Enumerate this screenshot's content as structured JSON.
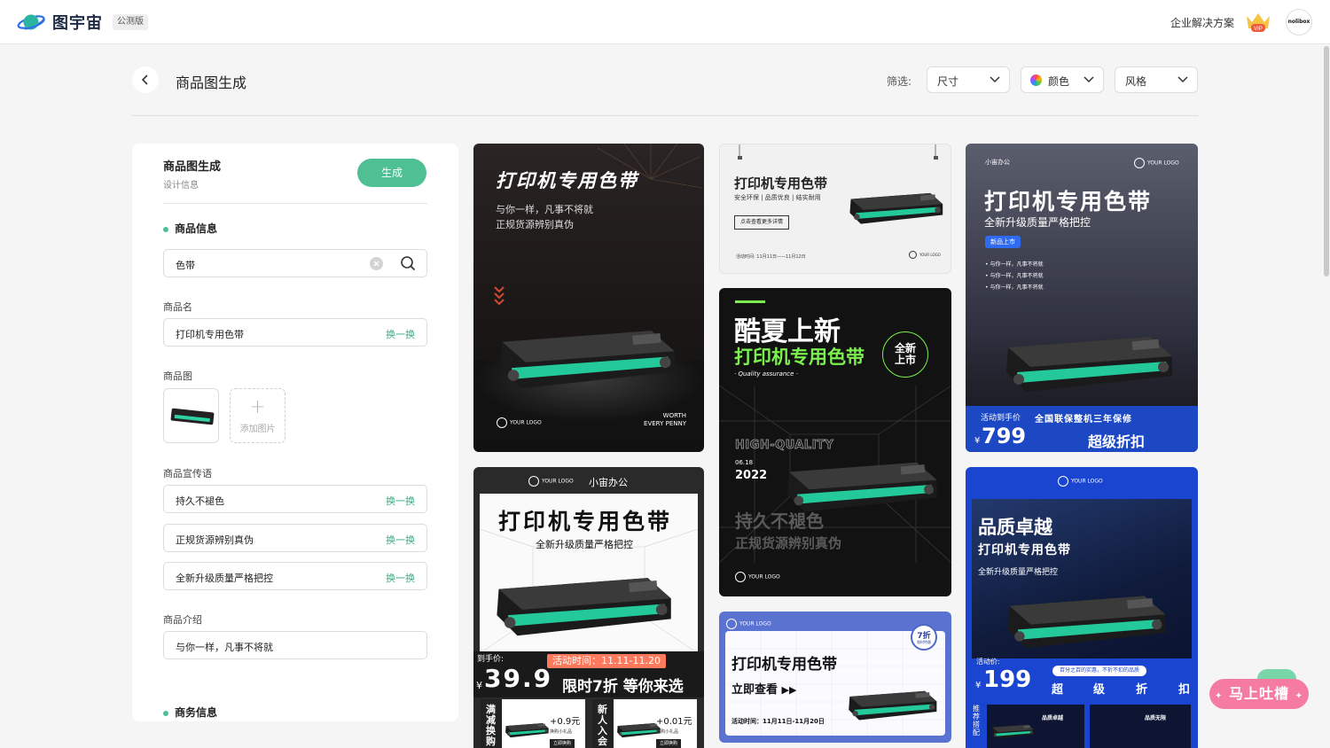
{
  "header": {
    "logo_text": "图宇宙",
    "badge": "公测版",
    "enterprise_link": "企业解决方案",
    "vip_label": "VIP",
    "avatar_text": "nolibox"
  },
  "toolbar": {
    "title": "商品图生成",
    "filter_label": "筛选:",
    "filters": [
      {
        "label": "尺寸"
      },
      {
        "label": "颜色"
      },
      {
        "label": "风格"
      }
    ]
  },
  "panel": {
    "title": "商品图生成",
    "subtitle": "设计信息",
    "generate_label": "生成",
    "product_section": "商品信息",
    "search_value": "色带",
    "name_label": "商品名",
    "name_value": "打印机专用色带",
    "swap_label": "换一换",
    "image_label": "商品图",
    "add_image_label": "添加图片",
    "slogan_label": "商品宣传语",
    "slogans": [
      "持久不褪色",
      "正规货源辨别真伪",
      "全新升级质量严格把控"
    ],
    "intro_label": "商品介绍",
    "intro_value": "与你一样，凡事不将就",
    "business_section": "商务信息"
  },
  "cards": {
    "c1": {
      "title": "打印机专用色带",
      "line1": "与你一样，凡事不将就",
      "line2": "正规货源辨别真伪",
      "logo": "YOUR LOGO",
      "tag1": "WORTH",
      "tag2": "EVERY PENNY"
    },
    "c2": {
      "title": "打印机专用色带",
      "sub": "安全环保 | 品质优良 | 结实耐用",
      "btn": "点击查看更多详情",
      "date": "活动时间: 11月11日——11月12日",
      "logo": "YOUR LOGO"
    },
    "c3": {
      "brand": "小宙办公",
      "logo": "YOUR LOGO",
      "title": "打印机专用色带",
      "sub": "全新升级质量严格把控",
      "badge": "新品上市",
      "bullets": [
        "• 与你一样，凡事不将就",
        "• 与你一样，凡事不将就",
        "• 与你一样，凡事不将就"
      ],
      "price_label": "活动到手价",
      "warranty": "全国联保整机三年保修",
      "price": "799",
      "currency": "¥",
      "promo": "超级折扣"
    },
    "c4": {
      "headline": "酷夏上新",
      "title": "打印机专用色带",
      "qa": "· Quality assurance ·",
      "round": "全新上市",
      "hq": "HIGH-QUALITY",
      "date": "06.18",
      "year": "2022",
      "l1": "持久不褪色",
      "l2": "正规货源辨别真伪",
      "logo": "YOUR LOGO"
    },
    "c5": {
      "logo": "YOUR LOGO",
      "brand": "小宙办公",
      "title": "打印机专用色带",
      "sub": "全新升级质量严格把控",
      "price_label": "到手价:",
      "activity": "活动时间：11.11-11.20",
      "currency": "¥",
      "price": "39.9",
      "promo": "限时7折 等你来选",
      "side1": "满减换购",
      "add1": "+0.9元",
      "gift1": "换购小礼品",
      "side2": "新人入会",
      "add2": "+0.01元",
      "gift2": "换购小礼品",
      "mini_btn": "立即换购"
    },
    "c6": {
      "logo": "YOUR LOGO",
      "discount": "7折",
      "discount_sub": "限时特惠",
      "title": "打印机专用色带",
      "cta": "立即查看",
      "date": "活动时间：11月11日-11月20日"
    },
    "c7": {
      "logo": "YOUR LOGO",
      "headline": "品质卓越",
      "title": "打印机专用色带",
      "sub": "全新升级质量严格把控",
      "price_label": "活动价:",
      "currency": "¥",
      "price": "199",
      "note": "百分之百的实惠，不折不扣的品质",
      "promo": [
        "超",
        "级",
        "折",
        "扣"
      ],
      "side": "推荐搭配",
      "mini1": "品质卓越",
      "mini2": "品质无限"
    }
  },
  "feedback": {
    "label": "马上吐槽"
  },
  "colors": {
    "accent": "#4fbf94",
    "swap": "#3aae80",
    "feedback": "#f57ba2",
    "card_blue": "#1747c7",
    "card_green": "#7bf04e"
  }
}
